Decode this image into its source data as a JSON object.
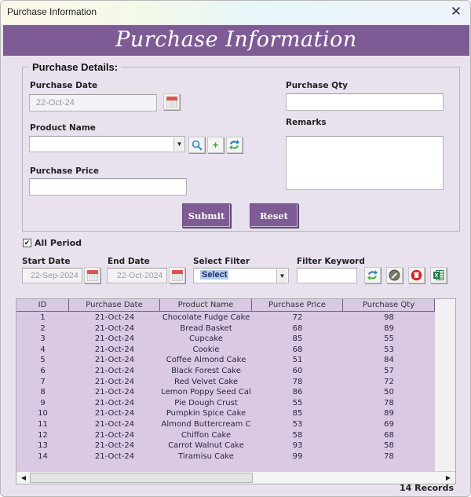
{
  "window": {
    "title": "Purchase Information",
    "close_icon": "close-icon"
  },
  "banner": {
    "title": "Purchase Information"
  },
  "details": {
    "legend": "Purchase Details:",
    "purchase_date": {
      "label": "Purchase Date",
      "value": "22-Oct-24"
    },
    "product_name": {
      "label": "Product Name",
      "value": ""
    },
    "purchase_price": {
      "label": "Purchase Price",
      "value": ""
    },
    "purchase_qty": {
      "label": "Purchase Qty",
      "value": ""
    },
    "remarks": {
      "label": "Remarks",
      "value": ""
    },
    "submit_label": "Submit",
    "reset_label": "Reset"
  },
  "filters": {
    "all_period": {
      "label": "All Period",
      "checked": true,
      "mark": "✔"
    },
    "start_date": {
      "label": "Start Date",
      "value": "22-Sep-2024"
    },
    "end_date": {
      "label": "End Date",
      "value": "22-Oct-2024"
    },
    "select_filter": {
      "label": "Select Filter",
      "value": "Select"
    },
    "filter_keyword": {
      "label": "Filter Keyword",
      "value": ""
    }
  },
  "table": {
    "columns": [
      "ID",
      "Purchase Date",
      "Product Name",
      "Purchase Price",
      "Purchase Qty"
    ],
    "rows": [
      [
        "1",
        "21-Oct-24",
        "Chocolate Fudge Cake",
        "72",
        "98"
      ],
      [
        "2",
        "21-Oct-24",
        "Bread Basket",
        "68",
        "89"
      ],
      [
        "3",
        "21-Oct-24",
        "Cupcake",
        "85",
        "55"
      ],
      [
        "4",
        "21-Oct-24",
        "Cookie",
        "68",
        "53"
      ],
      [
        "5",
        "21-Oct-24",
        "Coffee Almond Cake",
        "51",
        "84"
      ],
      [
        "6",
        "21-Oct-24",
        "Black Forest Cake",
        "60",
        "57"
      ],
      [
        "7",
        "21-Oct-24",
        "Red Velvet Cake",
        "78",
        "72"
      ],
      [
        "8",
        "21-Oct-24",
        "Lemon Poppy Seed Cal",
        "86",
        "50"
      ],
      [
        "9",
        "21-Oct-24",
        "Pie Dough Crust",
        "55",
        "78"
      ],
      [
        "10",
        "21-Oct-24",
        "Pumpkin Spice Cake",
        "85",
        "89"
      ],
      [
        "11",
        "21-Oct-24",
        "Almond Buttercream C",
        "53",
        "69"
      ],
      [
        "12",
        "21-Oct-24",
        "Chiffon Cake",
        "58",
        "68"
      ],
      [
        "13",
        "21-Oct-24",
        "Carrot Walnut Cake",
        "93",
        "58"
      ],
      [
        "14",
        "21-Oct-24",
        "Tiramisu Cake",
        "99",
        "78"
      ]
    ]
  },
  "status": {
    "records": "14 Records"
  },
  "colors": {
    "brand_purple": "#7e5b94",
    "grid_bg": "#d9c9e3",
    "window_bg": "#e9e2ee"
  }
}
